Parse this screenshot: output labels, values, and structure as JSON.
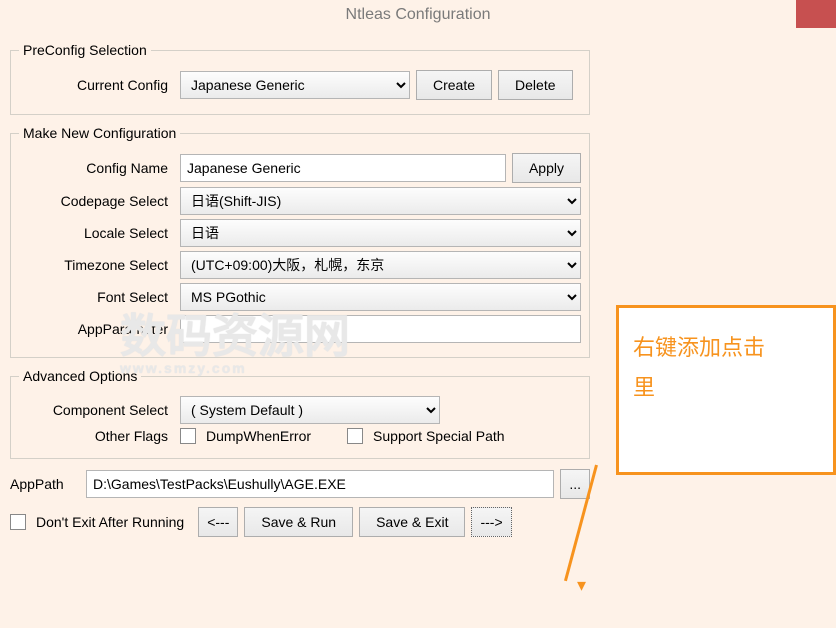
{
  "title": "Ntleas Configuration",
  "preconfig": {
    "legend": "PreConfig Selection",
    "current_label": "Current Config",
    "current_value": "Japanese Generic",
    "create_btn": "Create",
    "delete_btn": "Delete"
  },
  "makenew": {
    "legend": "Make New Configuration",
    "name_label": "Config Name",
    "name_value": "Japanese Generic",
    "apply_btn": "Apply",
    "codepage_label": "Codepage Select",
    "codepage_value": "日语(Shift-JIS)",
    "locale_label": "Locale Select",
    "locale_value": "日语",
    "timezone_label": "Timezone Select",
    "timezone_value": "(UTC+09:00)大阪，札幌，东京",
    "font_label": "Font Select",
    "font_value": "MS PGothic",
    "appparam_label": "AppParameter",
    "appparam_value": ""
  },
  "advanced": {
    "legend": "Advanced Options",
    "component_label": "Component Select",
    "component_value": "( System Default )",
    "flags_label": "Other Flags",
    "dump_label": "DumpWhenError",
    "support_label": "Support Special Path"
  },
  "apppath": {
    "label": "AppPath",
    "value": "D:\\Games\\TestPacks\\Eushully\\AGE.EXE",
    "browse": "..."
  },
  "bottom": {
    "dont_exit": "Don't Exit After Running",
    "prev": "<---",
    "save_run": "Save & Run",
    "save_exit": "Save & Exit",
    "next": "--->"
  },
  "callout": {
    "line1": "右键添加点击",
    "line2": "里"
  },
  "watermark": {
    "main": "数码资源网",
    "sub": "www.smzy.com"
  }
}
